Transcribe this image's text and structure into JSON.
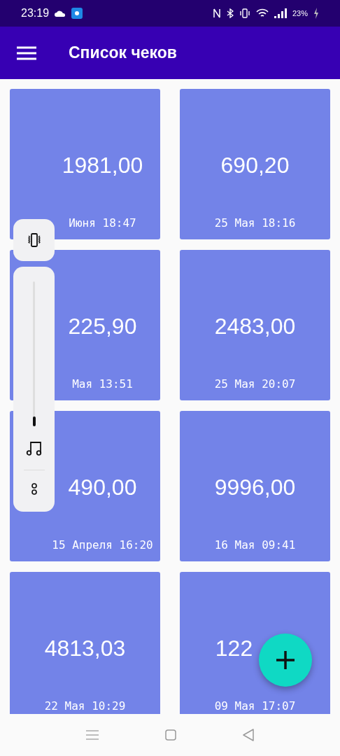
{
  "status_bar": {
    "time": "23:19",
    "battery": "23%"
  },
  "app_bar": {
    "title": "Список чеков"
  },
  "receipts": [
    {
      "kind": "leftcovered",
      "amount": "1981,00",
      "date": "Июня 18:47"
    },
    {
      "kind": "plain",
      "amount": "690,20",
      "date": "25 Мая 18:16"
    },
    {
      "kind": "leftcovered",
      "amount": "225,90",
      "date": "Мая 13:51"
    },
    {
      "kind": "plain",
      "amount": "2483,00",
      "date": "25 Мая 20:07"
    },
    {
      "kind": "leftcovered",
      "amount": "490,00",
      "date": "15 Апреля 16:20"
    },
    {
      "kind": "plain",
      "amount": "9996,00",
      "date": "16 Мая 09:41"
    },
    {
      "kind": "plain",
      "amount": "4813,03",
      "date": "22 Мая 10:29"
    },
    {
      "kind": "rightcovered",
      "amount": "122",
      "date": "09 Мая 17:07"
    }
  ],
  "volume_panel": {
    "level": 0.05
  }
}
